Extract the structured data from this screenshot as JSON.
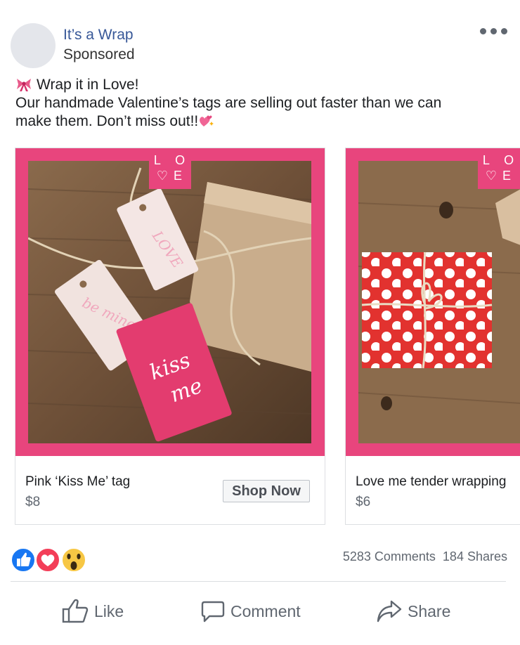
{
  "post": {
    "page_name": "It’s a Wrap",
    "sponsored": "Sponsored",
    "line1": "Wrap it in Love!",
    "line2": "Our handmade Valentine’s tags are selling out faster than we can",
    "line3": "make them. Don’t miss out!!"
  },
  "carousel": [
    {
      "badge_top": "L O",
      "badge_bottom": "♡E",
      "title": "Pink ‘Kiss Me’ tag",
      "price": "$8",
      "cta": "Shop Now",
      "tag_script_1": "kiss",
      "tag_script_2": "me",
      "tag_script_3": "be mine",
      "tag_script_4": "LOVE"
    },
    {
      "badge_top": "L O",
      "badge_bottom": "♡E",
      "title": "Love me tender wrapping",
      "price": "$6"
    }
  ],
  "stats": {
    "comments": "5283 Comments",
    "shares": "184 Shares"
  },
  "actions": {
    "like": "Like",
    "comment": "Comment",
    "share": "Share"
  },
  "colors": {
    "brand_pink": "#e8457d",
    "link_blue": "#385898",
    "like_blue": "#1877f2",
    "love_red": "#f33e58"
  },
  "icons": [
    "bow-emoji-icon",
    "sparkling-heart-icon",
    "more-icon",
    "like-reaction-icon",
    "love-reaction-icon",
    "wow-reaction-icon",
    "thumbs-up-icon",
    "comment-icon",
    "share-icon"
  ]
}
